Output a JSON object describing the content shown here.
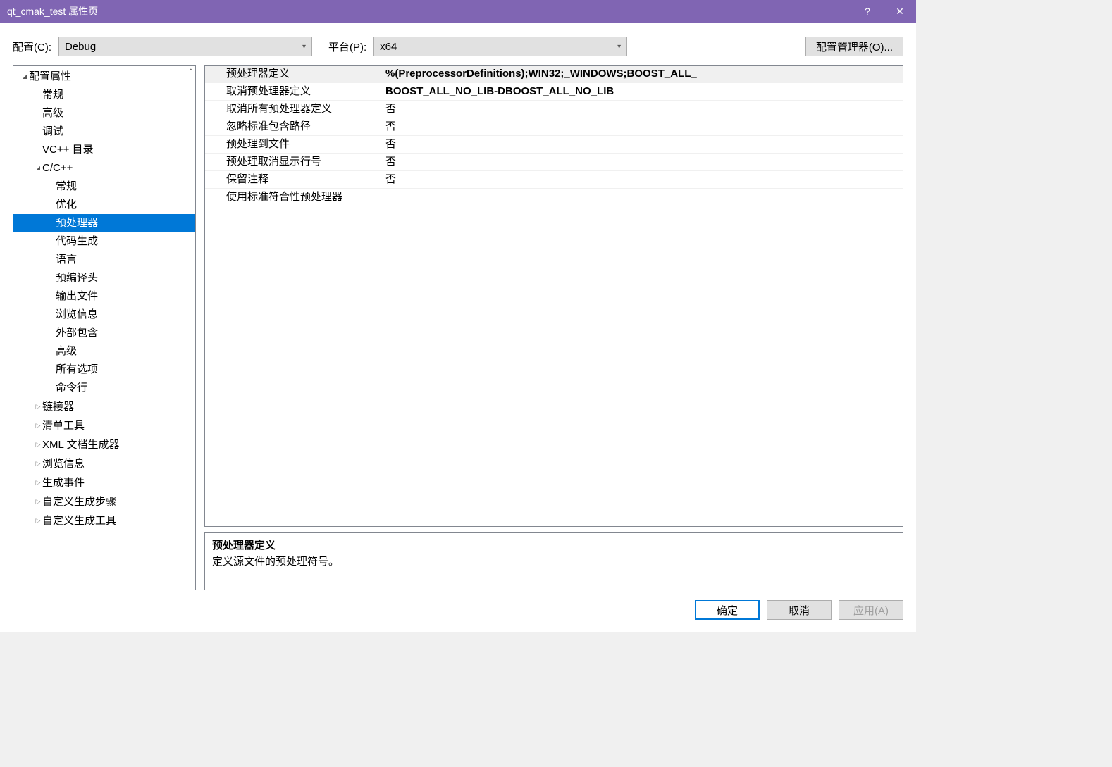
{
  "titlebar": {
    "title": "qt_cmak_test 属性页",
    "help": "?",
    "close": "✕"
  },
  "toolbar": {
    "config_label": "配置(C):",
    "config_value": "Debug",
    "platform_label": "平台(P):",
    "platform_value": "x64",
    "config_mgr": "配置管理器(O)..."
  },
  "tree": {
    "items": [
      {
        "label": "配置属性",
        "level": 0,
        "arrow": "open"
      },
      {
        "label": "常规",
        "level": 1,
        "arrow": "none"
      },
      {
        "label": "高级",
        "level": 1,
        "arrow": "none"
      },
      {
        "label": "调试",
        "level": 1,
        "arrow": "none"
      },
      {
        "label": "VC++ 目录",
        "level": 1,
        "arrow": "none"
      },
      {
        "label": "C/C++",
        "level": 1,
        "arrow": "open"
      },
      {
        "label": "常规",
        "level": 2,
        "arrow": "none"
      },
      {
        "label": "优化",
        "level": 2,
        "arrow": "none"
      },
      {
        "label": "预处理器",
        "level": 2,
        "arrow": "none",
        "selected": true
      },
      {
        "label": "代码生成",
        "level": 2,
        "arrow": "none"
      },
      {
        "label": "语言",
        "level": 2,
        "arrow": "none"
      },
      {
        "label": "预编译头",
        "level": 2,
        "arrow": "none"
      },
      {
        "label": "输出文件",
        "level": 2,
        "arrow": "none"
      },
      {
        "label": "浏览信息",
        "level": 2,
        "arrow": "none"
      },
      {
        "label": "外部包含",
        "level": 2,
        "arrow": "none"
      },
      {
        "label": "高级",
        "level": 2,
        "arrow": "none"
      },
      {
        "label": "所有选项",
        "level": 2,
        "arrow": "none"
      },
      {
        "label": "命令行",
        "level": 2,
        "arrow": "none"
      },
      {
        "label": "链接器",
        "level": 1,
        "arrow": "closed"
      },
      {
        "label": "清单工具",
        "level": 1,
        "arrow": "closed"
      },
      {
        "label": "XML 文档生成器",
        "level": 1,
        "arrow": "closed"
      },
      {
        "label": "浏览信息",
        "level": 1,
        "arrow": "closed"
      },
      {
        "label": "生成事件",
        "level": 1,
        "arrow": "closed"
      },
      {
        "label": "自定义生成步骤",
        "level": 1,
        "arrow": "closed"
      },
      {
        "label": "自定义生成工具",
        "level": 1,
        "arrow": "closed"
      }
    ]
  },
  "properties": {
    "rows": [
      {
        "label": "预处理器定义",
        "value": "%(PreprocessorDefinitions);WIN32;_WINDOWS;BOOST_ALL_",
        "bold": true,
        "selected": true
      },
      {
        "label": "取消预处理器定义",
        "value": "BOOST_ALL_NO_LIB-DBOOST_ALL_NO_LIB",
        "bold": true
      },
      {
        "label": "取消所有预处理器定义",
        "value": "否"
      },
      {
        "label": "忽略标准包含路径",
        "value": "否"
      },
      {
        "label": "预处理到文件",
        "value": "否"
      },
      {
        "label": "预处理取消显示行号",
        "value": "否"
      },
      {
        "label": "保留注释",
        "value": "否"
      },
      {
        "label": "使用标准符合性预处理器",
        "value": ""
      }
    ]
  },
  "description": {
    "title": "预处理器定义",
    "text": "定义源文件的预处理符号。"
  },
  "footer": {
    "ok": "确定",
    "cancel": "取消",
    "apply": "应用(A)"
  }
}
